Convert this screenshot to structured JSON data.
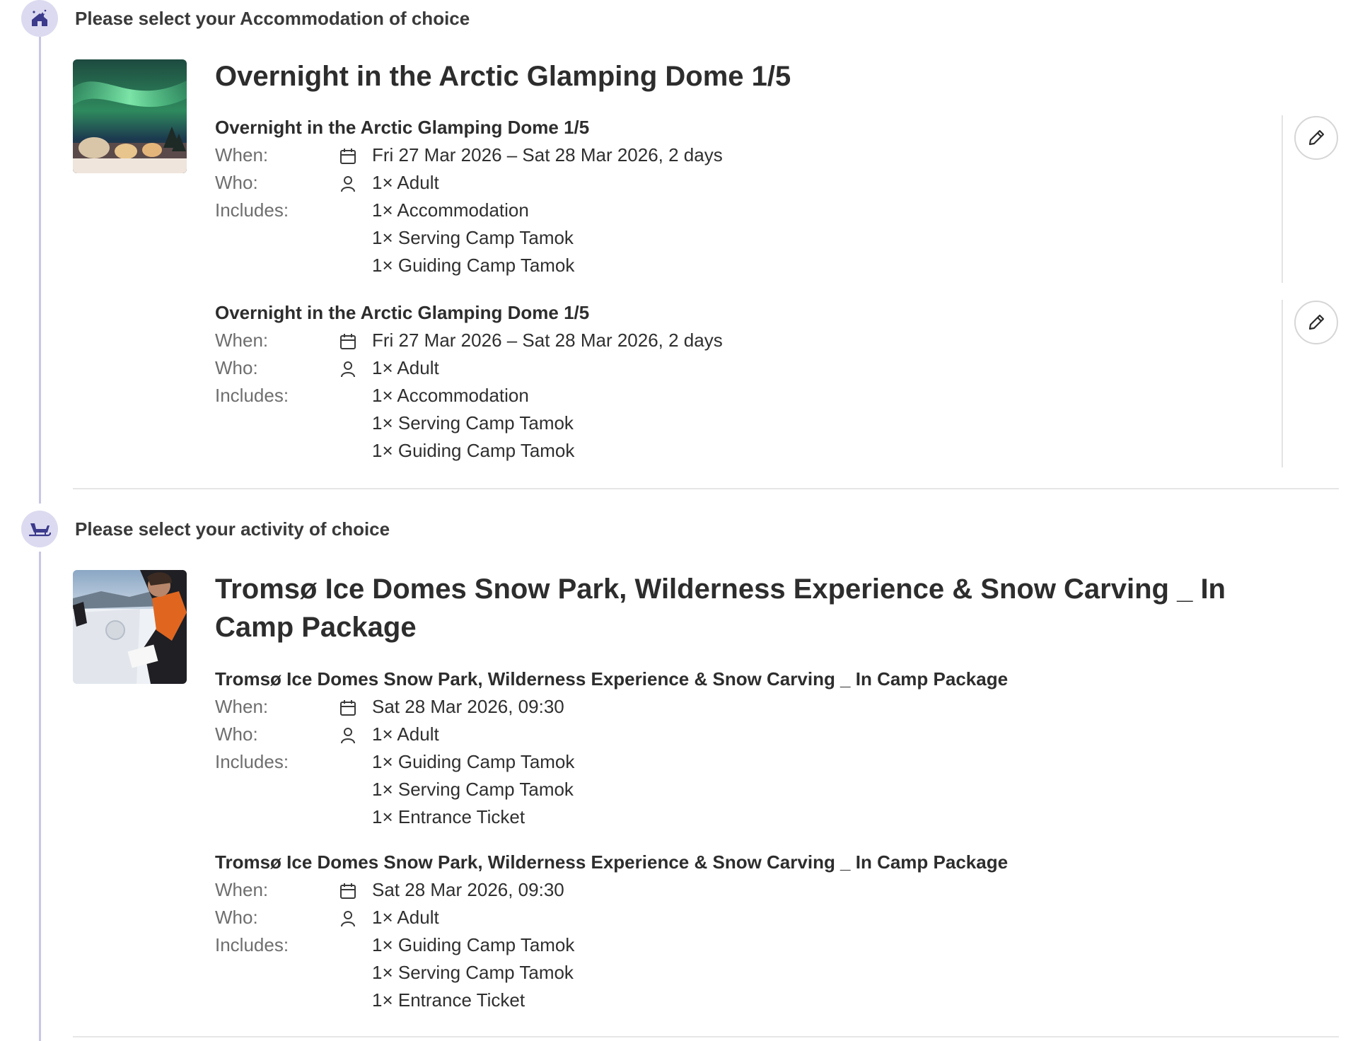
{
  "colors": {
    "accent": "#3b3a8c",
    "timeline": "#c8c6e6",
    "icon_bg": "#dcdaf0"
  },
  "sections": [
    {
      "header": "Please select your Accommodation of choice",
      "header_icon": "glamping-dome-icon",
      "product_title": "Overnight in the Arctic Glamping Dome 1/5",
      "thumbnail": "northern-lights-dome-photo",
      "items": [
        {
          "title": "Overnight in the Arctic Glamping Dome 1/5",
          "when_label": "When:",
          "when": "Fri 27 Mar 2026 – Sat 28 Mar 2026, 2 days",
          "who_label": "Who:",
          "who": "1× Adult",
          "includes_label": "Includes:",
          "includes": [
            "1× Accommodation",
            "1× Serving Camp Tamok",
            "1× Guiding Camp Tamok"
          ]
        },
        {
          "title": "Overnight in the Arctic Glamping Dome 1/5",
          "when_label": "When:",
          "when": "Fri 27 Mar 2026 – Sat 28 Mar 2026, 2 days",
          "who_label": "Who:",
          "who": "1× Adult",
          "includes_label": "Includes:",
          "includes": [
            "1× Accommodation",
            "1× Serving Camp Tamok",
            "1× Guiding Camp Tamok"
          ]
        }
      ]
    },
    {
      "header": "Please select your activity of choice",
      "header_icon": "sleigh-icon",
      "product_title": "Tromsø Ice Domes Snow Park, Wilderness Experience & Snow Carving _ In Camp Package",
      "thumbnail": "snow-carving-photo",
      "items": [
        {
          "title": "Tromsø Ice Domes Snow Park, Wilderness Experience & Snow Carving _ In Camp Package",
          "when_label": "When:",
          "when": "Sat 28 Mar 2026, 09:30",
          "who_label": "Who:",
          "who": "1× Adult",
          "includes_label": "Includes:",
          "includes": [
            "1× Guiding Camp Tamok",
            "1× Serving Camp Tamok",
            "1× Entrance Ticket"
          ]
        },
        {
          "title": "Tromsø Ice Domes Snow Park, Wilderness Experience & Snow Carving _ In Camp Package",
          "when_label": "When:",
          "when": "Sat 28 Mar 2026, 09:30",
          "who_label": "Who:",
          "who": "1× Adult",
          "includes_label": "Includes:",
          "includes": [
            "1× Guiding Camp Tamok",
            "1× Serving Camp Tamok",
            "1× Entrance Ticket"
          ]
        }
      ]
    }
  ]
}
